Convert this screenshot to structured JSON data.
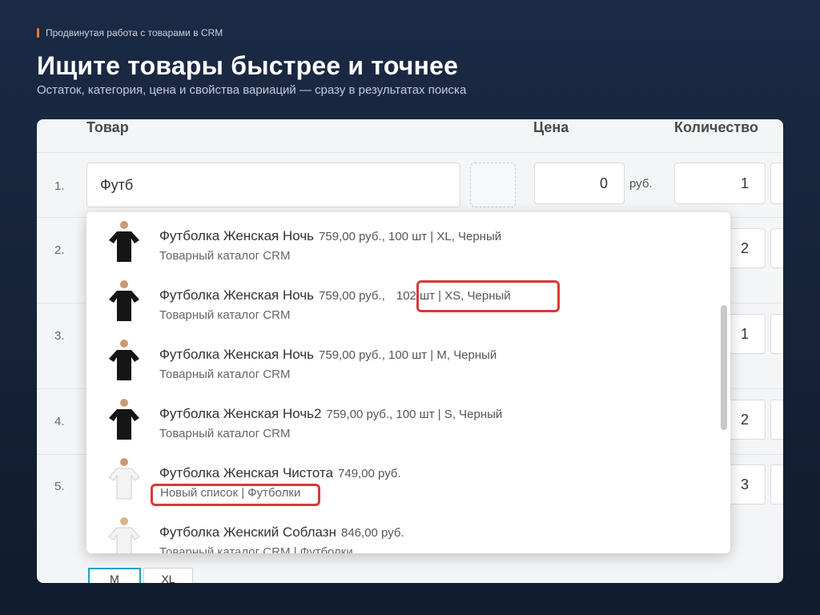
{
  "slide": {
    "eyebrow": "Продвинутая работа с товарами в CRM",
    "title": "Ищите товары быстрее и точнее",
    "subtitle": "Остаток, категория, цена и свойства вариаций — сразу в результатах поиска",
    "accent_color": "#e8743b",
    "highlight_color": "#d83a34"
  },
  "table": {
    "headers": {
      "product": "Товар",
      "price": "Цена",
      "qty": "Количество"
    },
    "currency": "руб.",
    "rows": [
      {
        "num": "1.",
        "product": "Футб",
        "price": "0",
        "qty": "1"
      },
      {
        "num": "2.",
        "qty": "2"
      },
      {
        "num": "3.",
        "qty": "1"
      },
      {
        "num": "4.",
        "qty": "2"
      },
      {
        "num": "5.",
        "qty": "3"
      }
    ],
    "size_chips": [
      {
        "label": "M",
        "selected": true
      },
      {
        "label": "XL",
        "selected": false
      }
    ]
  },
  "dropdown": {
    "items": [
      {
        "name": "Футболка Женская Ночь",
        "info": "759,00 руб., 100 шт | XL, Черный",
        "sub": "Товарный каталог CRM",
        "shirt_color": "#151515"
      },
      {
        "name": "Футболка Женская Ночь",
        "info": "759,00 руб.,",
        "info_hl": "102 шт | XS, Черный",
        "sub": "Товарный каталог CRM",
        "shirt_color": "#151515"
      },
      {
        "name": "Футболка Женская Ночь",
        "info": "759,00 руб., 100 шт | M, Черный",
        "sub": "Товарный каталог CRM",
        "shirt_color": "#151515"
      },
      {
        "name": "Футболка Женская Ночь2",
        "info": "759,00 руб., 100 шт | S, Черный",
        "sub": "Товарный каталог CRM",
        "shirt_color": "#151515"
      },
      {
        "name": "Футболка Женская Чистота",
        "info": "749,00 руб.",
        "sub": "Новый список | Футболки",
        "shirt_color": "#f3f3f3"
      },
      {
        "name": "Футболка Женский Соблазн",
        "info": "846,00 руб.",
        "sub": "Товарный каталог CRM | Футболки",
        "shirt_color": "#f3f3f3"
      }
    ]
  }
}
